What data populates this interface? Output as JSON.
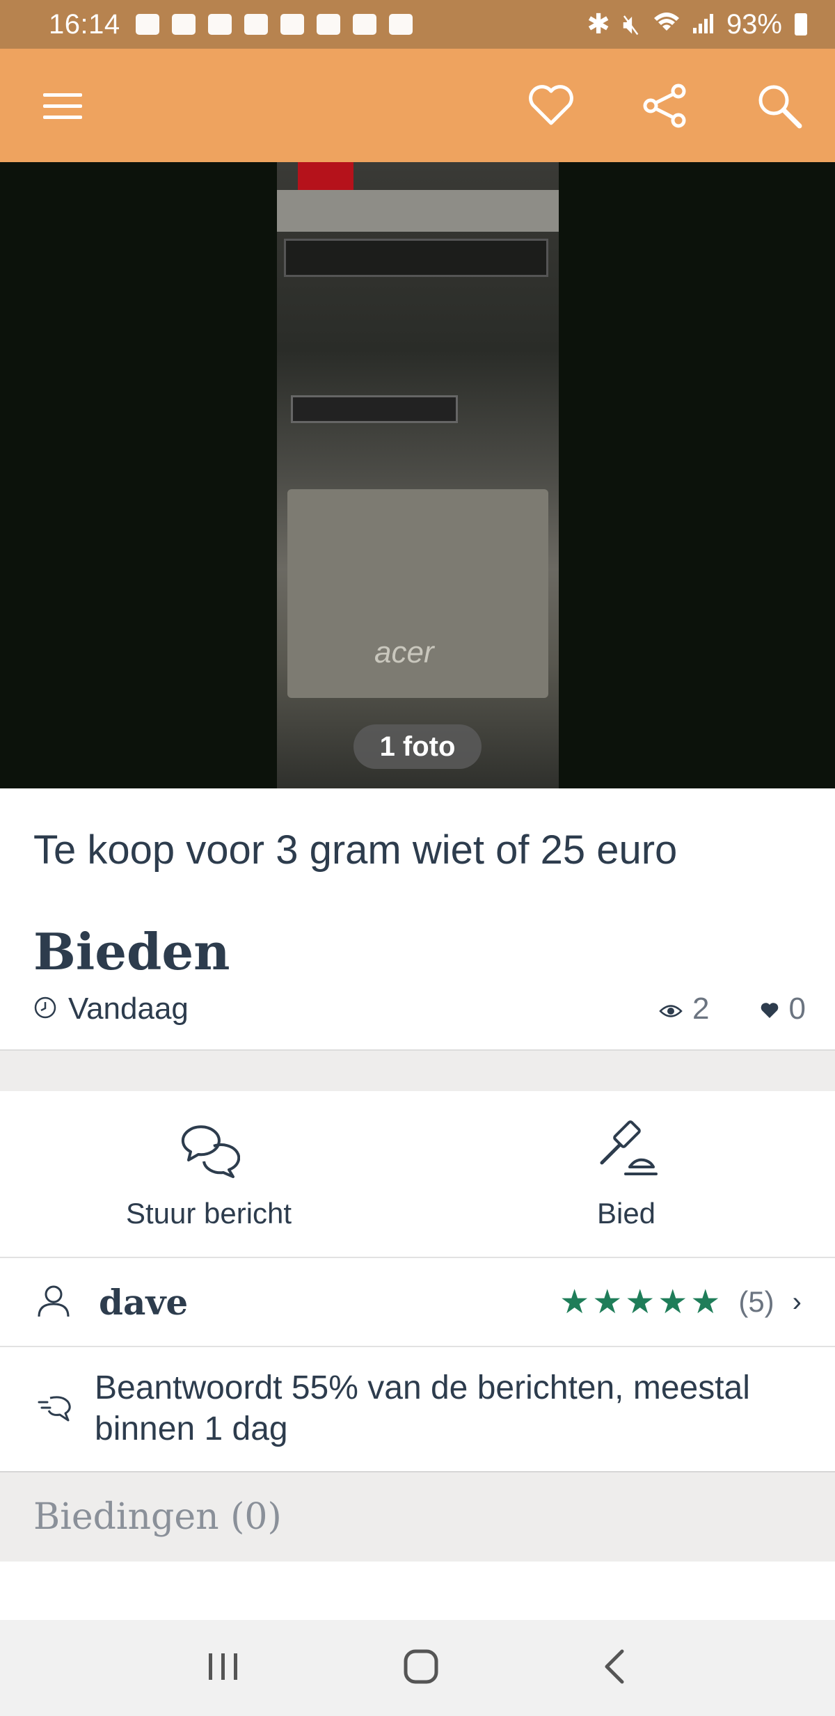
{
  "status_bar": {
    "time": "16:14",
    "battery": "93%"
  },
  "app_bar": {
    "menu_icon": "hamburger-icon",
    "favorite_icon": "heart-icon",
    "share_icon": "share-icon",
    "search_icon": "search-icon"
  },
  "photo": {
    "badge": "1 foto",
    "brand_text": "acer"
  },
  "listing": {
    "title": "Te koop voor 3 gram wiet of 25 euro",
    "price": "Bieden",
    "date": "Vandaag",
    "views": "2",
    "favorites": "0"
  },
  "actions": {
    "message_label": "Stuur bericht",
    "bid_label": "Bied"
  },
  "seller": {
    "name": "dave",
    "stars": "★★★★★",
    "rating": 5,
    "reviews": "(5)",
    "chevron": "›",
    "star_color": "#1f7d59"
  },
  "response": {
    "text": "Beantwoordt 55% van de berichten, meestal binnen 1 dag"
  },
  "bids": {
    "label": "Biedingen (0)"
  },
  "colors": {
    "status_bar": "#b7834f",
    "app_bar": "#eea35f",
    "text": "#2d3c4d"
  }
}
